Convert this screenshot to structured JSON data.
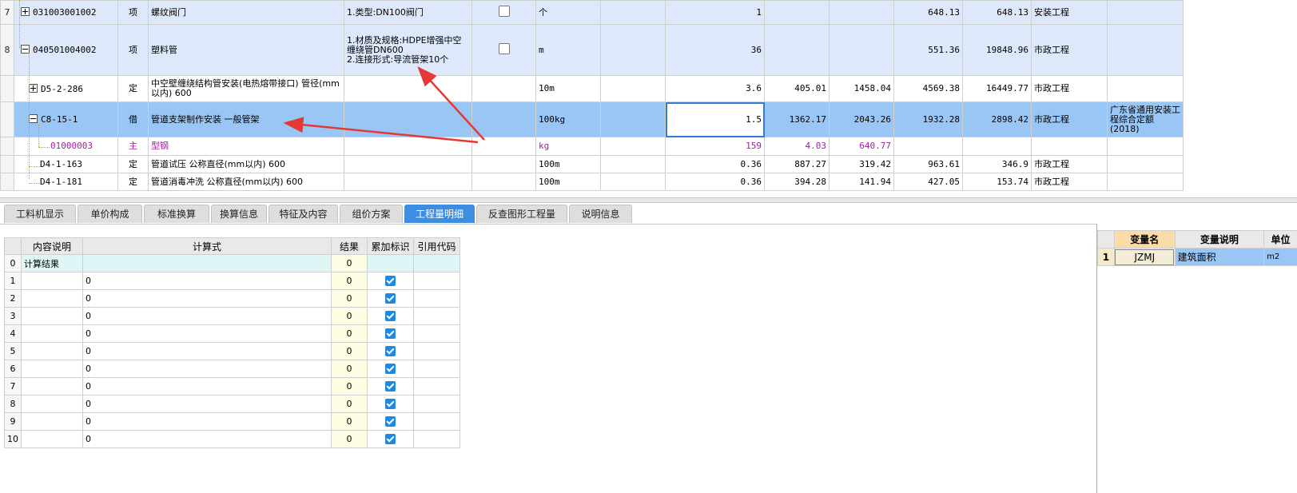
{
  "top_grid": {
    "rows": [
      {
        "rownum": "7",
        "code": "031003001002",
        "type": "项",
        "name": "螺纹阀门",
        "feature": "1.类型:DN100阀门",
        "unit": "个",
        "qty": "1",
        "price": "",
        "amount": "",
        "comp_price": "648.13",
        "comp_total": "648.13",
        "category": "安装工程",
        "quota_note": "",
        "style": "light",
        "expander": "plus"
      },
      {
        "rownum": "8",
        "code": "040501004002",
        "type": "项",
        "name": "塑料管",
        "feature": "1.材质及规格:HDPE增强中空缠绕管DN600\n2.连接形式:导流管架10个",
        "unit": "m",
        "qty": "36",
        "price": "",
        "amount": "",
        "comp_price": "551.36",
        "comp_total": "19848.96",
        "category": "市政工程",
        "quota_note": "",
        "style": "light",
        "expander": "minus"
      },
      {
        "rownum": "",
        "code": "D5-2-286",
        "type": "定",
        "name": "中空壁缠绕结构管安装(电热熔带接口) 管径(mm以内) 600",
        "feature": "",
        "unit": "10m",
        "qty": "3.6",
        "price": "405.01",
        "amount": "1458.04",
        "comp_price": "4569.38",
        "comp_total": "16449.77",
        "category": "市政工程",
        "quota_note": "",
        "style": "white",
        "expander": "plus"
      },
      {
        "rownum": "",
        "code": "C8-15-1",
        "type": "借",
        "name": "管道支架制作安装 一般管架",
        "feature": "",
        "unit": "100kg",
        "qty": "1.5",
        "price": "1362.17",
        "amount": "2043.26",
        "comp_price": "1932.28",
        "comp_total": "2898.42",
        "category": "市政工程",
        "quota_note": "广东省通用安装工程综合定额(2018)",
        "style": "sel",
        "expander": "minus"
      },
      {
        "rownum": "",
        "code": "01000003",
        "type": "主",
        "name": "型钢",
        "feature": "",
        "unit": "kg",
        "qty": "159",
        "price": "4.03",
        "amount": "640.77",
        "comp_price": "",
        "comp_total": "",
        "category": "",
        "quota_note": "",
        "style": "purple",
        "expander": ""
      },
      {
        "rownum": "",
        "code": "D4-1-163",
        "type": "定",
        "name": "管道试压 公称直径(mm以内) 600",
        "feature": "",
        "unit": "100m",
        "qty": "0.36",
        "price": "887.27",
        "amount": "319.42",
        "comp_price": "963.61",
        "comp_total": "346.9",
        "category": "市政工程",
        "quota_note": "",
        "style": "white",
        "expander": ""
      },
      {
        "rownum": "",
        "code": "D4-1-181",
        "type": "定",
        "name": "管道消毒冲洗 公称直径(mm以内) 600",
        "feature": "",
        "unit": "100m",
        "qty": "0.36",
        "price": "394.28",
        "amount": "141.94",
        "comp_price": "427.05",
        "comp_total": "153.74",
        "category": "市政工程",
        "quota_note": "",
        "style": "white",
        "expander": ""
      }
    ]
  },
  "tabs": [
    {
      "label": "工料机显示",
      "active": false
    },
    {
      "label": "单价构成",
      "active": false
    },
    {
      "label": "标准换算",
      "active": false
    },
    {
      "label": "换算信息",
      "active": false
    },
    {
      "label": "特征及内容",
      "active": false
    },
    {
      "label": "组价方案",
      "active": false
    },
    {
      "label": "工程量明细",
      "active": true
    },
    {
      "label": "反查图形工程量",
      "active": false
    },
    {
      "label": "说明信息",
      "active": false
    }
  ],
  "formula_grid": {
    "headers": [
      "",
      "内容说明",
      "计算式",
      "结果",
      "累加标识",
      "引用代码"
    ],
    "rows": [
      {
        "n": "0",
        "desc": "计算结果",
        "expr": "",
        "result": "0",
        "checked": false
      },
      {
        "n": "1",
        "desc": "",
        "expr": "0",
        "result": "0",
        "checked": true
      },
      {
        "n": "2",
        "desc": "",
        "expr": "0",
        "result": "0",
        "checked": true
      },
      {
        "n": "3",
        "desc": "",
        "expr": "0",
        "result": "0",
        "checked": true
      },
      {
        "n": "4",
        "desc": "",
        "expr": "0",
        "result": "0",
        "checked": true
      },
      {
        "n": "5",
        "desc": "",
        "expr": "0",
        "result": "0",
        "checked": true
      },
      {
        "n": "6",
        "desc": "",
        "expr": "0",
        "result": "0",
        "checked": true
      },
      {
        "n": "7",
        "desc": "",
        "expr": "0",
        "result": "0",
        "checked": true
      },
      {
        "n": "8",
        "desc": "",
        "expr": "0",
        "result": "0",
        "checked": true
      },
      {
        "n": "9",
        "desc": "",
        "expr": "0",
        "result": "0",
        "checked": true
      },
      {
        "n": "10",
        "desc": "",
        "expr": "0",
        "result": "0",
        "checked": true
      }
    ]
  },
  "variables": {
    "headers": [
      "",
      "变量名",
      "变量说明",
      "单位"
    ],
    "rows": [
      {
        "n": "1",
        "name": "JZMJ",
        "desc": "建筑面积",
        "unit": "m2"
      }
    ]
  },
  "colors": {
    "accent": "#3d8ee0",
    "selected_row": "#9ac6f5",
    "light_row": "#dde9fb",
    "arrow": "#e53935",
    "material_text": "#a020a0"
  }
}
